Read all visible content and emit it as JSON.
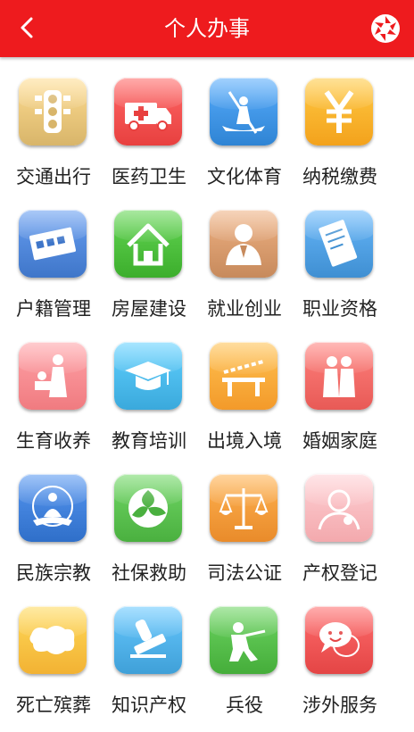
{
  "header": {
    "title": "个人办事",
    "back_icon": "chevron-left-icon",
    "action_icon": "aperture-icon",
    "bg": "#ee1b1e"
  },
  "items": [
    {
      "label": "交通出行",
      "icon": "traffic-light-icon",
      "color": "#d8b56a"
    },
    {
      "label": "医药卫生",
      "icon": "ambulance-icon",
      "color": "#e8403f"
    },
    {
      "label": "文化体育",
      "icon": "rowing-icon",
      "color": "#2f84d4"
    },
    {
      "label": "纳税缴费",
      "icon": "yen-icon",
      "color": "#f3a21c"
    },
    {
      "label": "户籍管理",
      "icon": "id-card-icon",
      "color": "#3f76c9"
    },
    {
      "label": "房屋建设",
      "icon": "house-icon",
      "color": "#3cae2c"
    },
    {
      "label": "就业创业",
      "icon": "worker-icon",
      "color": "#c78a5c"
    },
    {
      "label": "职业资格",
      "icon": "certificate-icon",
      "color": "#3f8fd2"
    },
    {
      "label": "生育收养",
      "icon": "mother-child-icon",
      "color": "#f07b80"
    },
    {
      "label": "教育培训",
      "icon": "graduation-cap-icon",
      "color": "#3aa9dc"
    },
    {
      "label": "出境入境",
      "icon": "border-gate-icon",
      "color": "#f39a2a"
    },
    {
      "label": "婚姻家庭",
      "icon": "couple-icon",
      "color": "#e85a56"
    },
    {
      "label": "民族宗教",
      "icon": "buddha-icon",
      "color": "#2f6fc9"
    },
    {
      "label": "社保救助",
      "icon": "social-security-icon",
      "color": "#4ab03f"
    },
    {
      "label": "司法公证",
      "icon": "scales-icon",
      "color": "#e98b2a"
    },
    {
      "label": "产权登记",
      "icon": "person-badge-icon",
      "color": "#f3a9ad"
    },
    {
      "label": "死亡殡葬",
      "icon": "cloud-scroll-icon",
      "color": "#f2b233"
    },
    {
      "label": "知识产权",
      "icon": "stamp-icon",
      "color": "#3fa0d8"
    },
    {
      "label": "兵役",
      "icon": "soldier-icon",
      "color": "#45ad3a"
    },
    {
      "label": "涉外服务",
      "icon": "speech-smile-icon",
      "color": "#e44545"
    }
  ]
}
